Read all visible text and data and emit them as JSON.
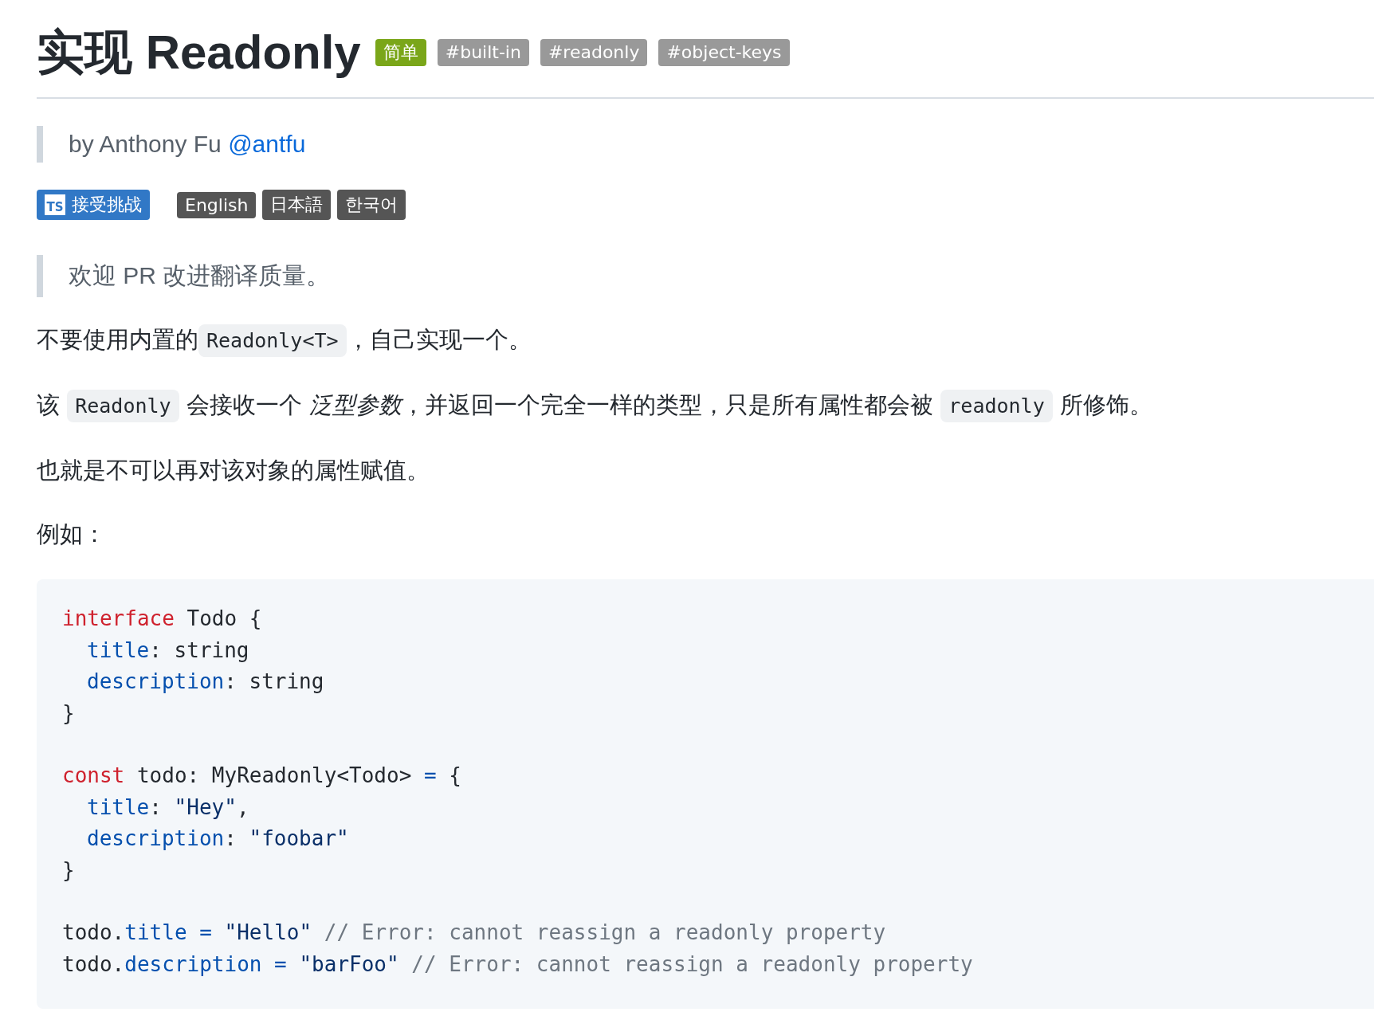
{
  "title": "实现 Readonly",
  "difficulty": {
    "label": "简单",
    "color": "#7aa619"
  },
  "tags": [
    "#built-in",
    "#readonly",
    "#object-keys"
  ],
  "author": {
    "prefix": "by Anthony Fu",
    "handle": "@antfu"
  },
  "challenge_button": {
    "icon": "TS",
    "label": "接受挑战"
  },
  "languages": [
    "English",
    "日本語",
    "한국어"
  ],
  "notice": "欢迎 PR 改进翻译质量。",
  "paragraphs": [
    [
      {
        "kind": "text",
        "text": "不要使用内置的"
      },
      {
        "kind": "code",
        "text": "Readonly<T>"
      },
      {
        "kind": "text",
        "text": "，自己实现一个。"
      }
    ],
    [
      {
        "kind": "text",
        "text": "该 "
      },
      {
        "kind": "code",
        "text": "Readonly"
      },
      {
        "kind": "text",
        "text": " 会接收一个 *泛型参数*，并返回一个完全一样的类型，只是所有属性都会被 "
      },
      {
        "kind": "code",
        "text": "readonly"
      },
      {
        "kind": "text",
        "text": " 所修饰。"
      }
    ],
    [
      {
        "kind": "text",
        "text": "也就是不可以再对该对象的属性赋值。"
      }
    ],
    [
      {
        "kind": "text",
        "text": "例如："
      }
    ]
  ],
  "code_blocks": [
    [
      {
        "indent": false,
        "tokens": [
          {
            "kind": "keyword",
            "text": "interface"
          },
          {
            "kind": "plain",
            "text": " Todo {"
          }
        ]
      },
      {
        "indent": true,
        "tokens": [
          {
            "kind": "prop",
            "text": "title"
          },
          {
            "kind": "plain",
            "text": ": string"
          }
        ]
      },
      {
        "indent": true,
        "tokens": [
          {
            "kind": "prop",
            "text": "description"
          },
          {
            "kind": "plain",
            "text": ": string"
          }
        ]
      },
      {
        "indent": false,
        "tokens": [
          {
            "kind": "plain",
            "text": "}"
          }
        ]
      }
    ],
    [
      {
        "indent": false,
        "tokens": [
          {
            "kind": "keyword",
            "text": "const"
          },
          {
            "kind": "plain",
            "text": " todo: MyReadonly<Todo> "
          },
          {
            "kind": "prop",
            "text": "="
          },
          {
            "kind": "plain",
            "text": " {"
          }
        ]
      },
      {
        "indent": true,
        "tokens": [
          {
            "kind": "prop",
            "text": "title"
          },
          {
            "kind": "plain",
            "text": ": "
          },
          {
            "kind": "string",
            "text": "\"Hey\""
          },
          {
            "kind": "plain",
            "text": ","
          }
        ]
      },
      {
        "indent": true,
        "tokens": [
          {
            "kind": "prop",
            "text": "description"
          },
          {
            "kind": "plain",
            "text": ": "
          },
          {
            "kind": "string",
            "text": "\"foobar\""
          }
        ]
      },
      {
        "indent": false,
        "tokens": [
          {
            "kind": "plain",
            "text": "}"
          }
        ]
      }
    ],
    [
      {
        "indent": false,
        "tokens": [
          {
            "kind": "plain",
            "text": "todo."
          },
          {
            "kind": "prop",
            "text": "title"
          },
          {
            "kind": "prop",
            "text": " = "
          },
          {
            "kind": "string",
            "text": "\"Hello\""
          },
          {
            "kind": "comment",
            "text": " // Error: cannot reassign a readonly property"
          }
        ]
      },
      {
        "indent": false,
        "tokens": [
          {
            "kind": "plain",
            "text": "todo."
          },
          {
            "kind": "prop",
            "text": "description"
          },
          {
            "kind": "prop",
            "text": " = "
          },
          {
            "kind": "string",
            "text": "\"barFoo\""
          },
          {
            "kind": "comment",
            "text": " // Error: cannot reassign a readonly property"
          }
        ]
      }
    ]
  ]
}
